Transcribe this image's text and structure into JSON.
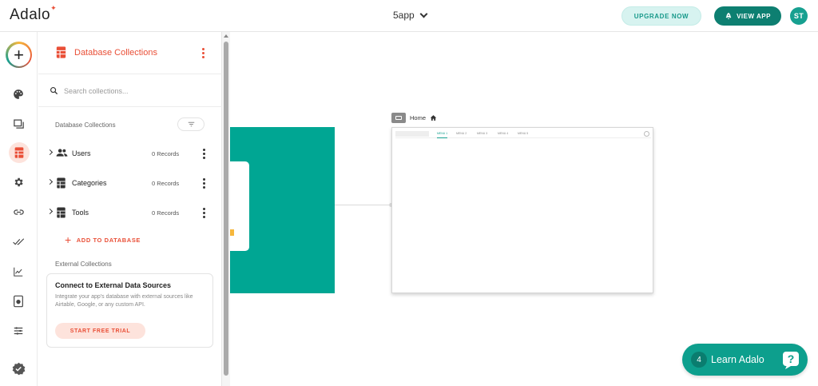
{
  "header": {
    "logo": "Adalo",
    "app_name": "5app",
    "upgrade_label": "UPGRADE NOW",
    "view_app_label": "VIEW APP",
    "avatar_initials": "ST"
  },
  "rail": {
    "items": [
      "add-icon",
      "palette-icon",
      "screens-icon",
      "database-icon",
      "gear-icon",
      "link-icon",
      "checkmarks-icon",
      "analytics-icon",
      "publish-icon",
      "sliders-icon",
      "verified-icon"
    ],
    "active": "database-icon"
  },
  "panel": {
    "title": "Database Collections",
    "search_placeholder": "Search collections...",
    "section_label": "Database Collections",
    "collections": [
      {
        "name": "Users",
        "records": "0 Records",
        "icon": "users-icon"
      },
      {
        "name": "Categories",
        "records": "0 Records",
        "icon": "table-icon"
      },
      {
        "name": "Tools",
        "records": "0 Records",
        "icon": "table-icon"
      }
    ],
    "add_label": "ADD TO DATABASE",
    "external_label": "External Collections",
    "external_card": {
      "title": "Connect to External Data Sources",
      "description": "Integrate your app's database with external sources like Airtable, Google, or any custom API.",
      "button": "START FREE TRIAL"
    }
  },
  "canvas": {
    "screen_name": "Home",
    "nav_items": [
      "MENU 1",
      "MENU 2",
      "MENU 3",
      "MENU 4",
      "MENU 5"
    ]
  },
  "learn": {
    "badge": "4",
    "label": "Learn Adalo"
  },
  "colors": {
    "brand_red": "#e94f37",
    "brand_teal": "#00a693",
    "teal_dark": "#0d7f71"
  }
}
